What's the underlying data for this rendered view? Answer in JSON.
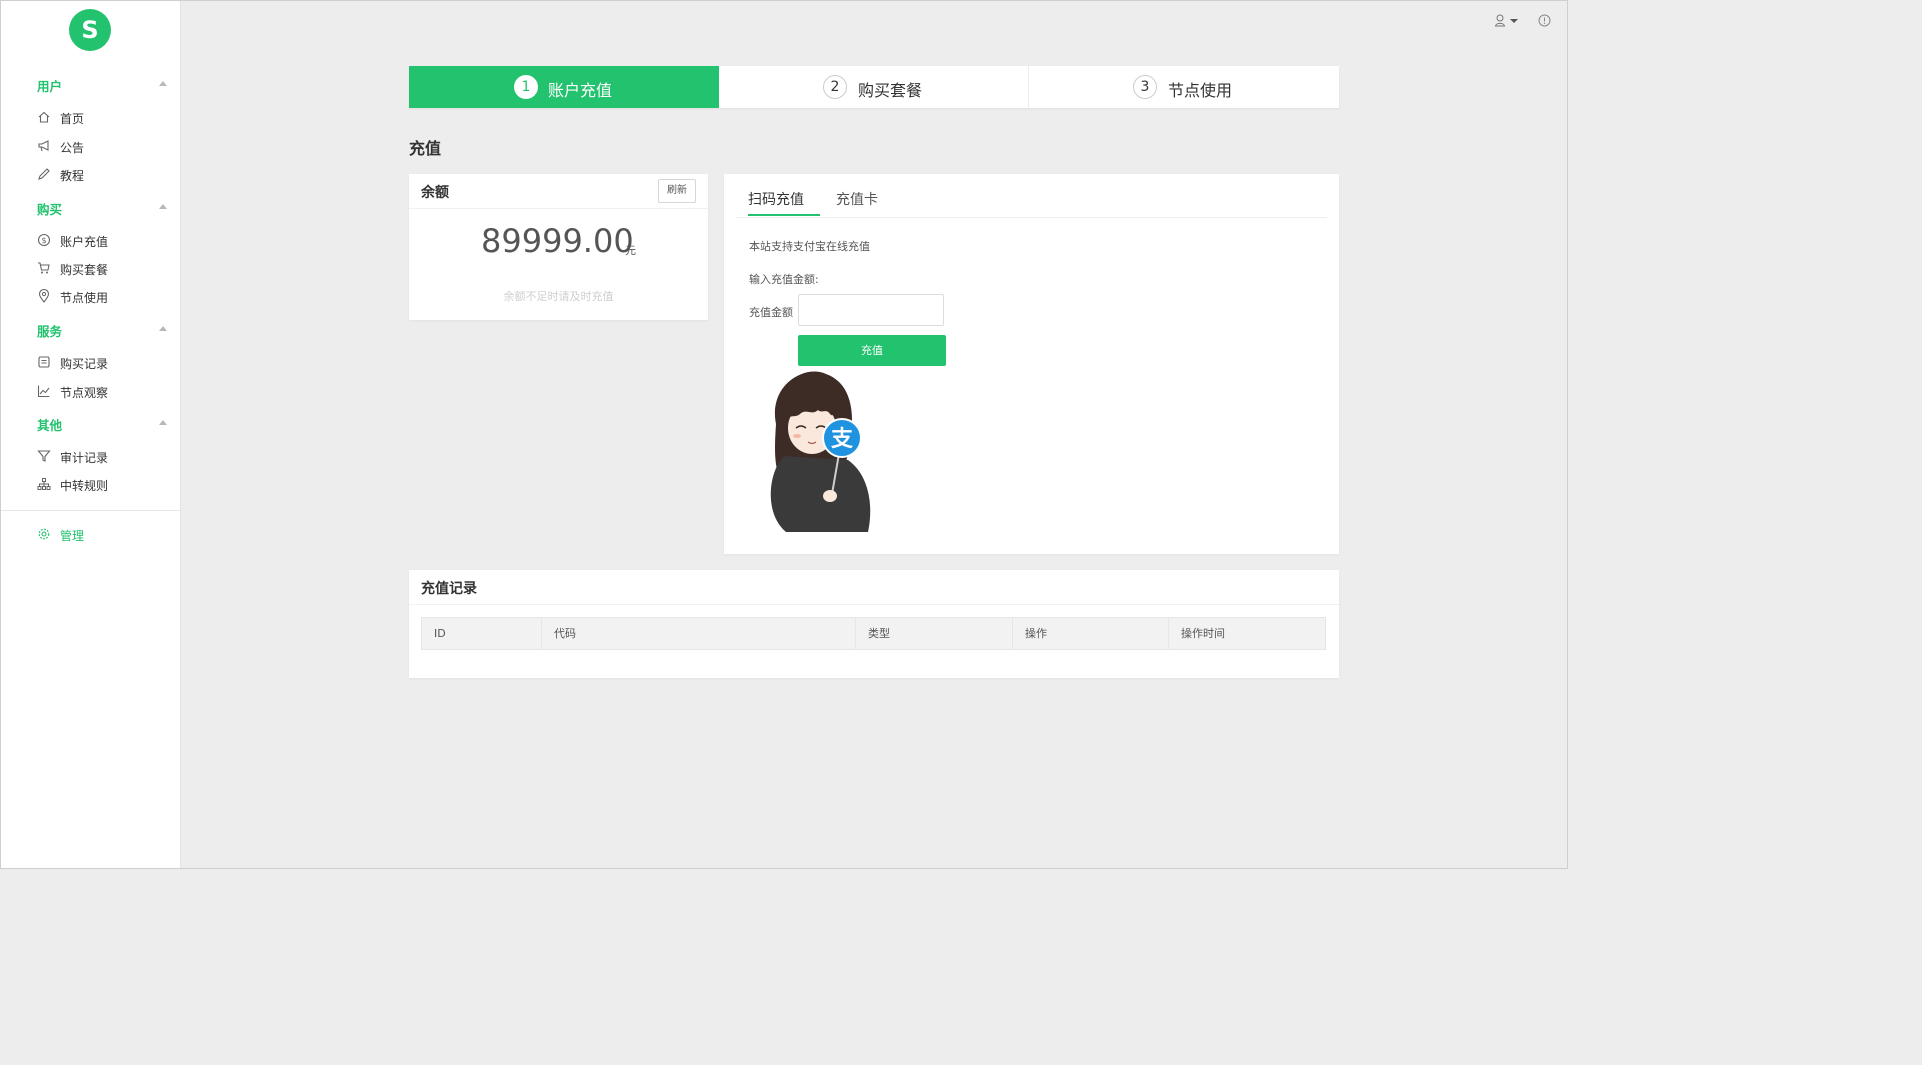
{
  "brand": {
    "logo_letter": "S",
    "accent": "#22c26e"
  },
  "sidebar": {
    "groups": [
      {
        "title": "用户",
        "items": [
          {
            "label": "首页",
            "icon": "home-icon"
          },
          {
            "label": "公告",
            "icon": "megaphone-icon"
          },
          {
            "label": "教程",
            "icon": "pencil-icon"
          }
        ]
      },
      {
        "title": "购买",
        "items": [
          {
            "label": "账户充值",
            "icon": "dollar-circle-icon"
          },
          {
            "label": "购买套餐",
            "icon": "cart-icon"
          },
          {
            "label": "节点使用",
            "icon": "location-pin-icon"
          }
        ]
      },
      {
        "title": "服务",
        "items": [
          {
            "label": "购买记录",
            "icon": "list-doc-icon"
          },
          {
            "label": "节点观察",
            "icon": "line-chart-icon"
          }
        ]
      },
      {
        "title": "其他",
        "items": [
          {
            "label": "审计记录",
            "icon": "filter-icon"
          },
          {
            "label": "中转规则",
            "icon": "sitemap-icon"
          }
        ]
      }
    ],
    "admin": {
      "label": "管理",
      "icon": "gear-icon"
    }
  },
  "steps": [
    {
      "num": "1",
      "label": "账户充值",
      "active": true
    },
    {
      "num": "2",
      "label": "购买套餐",
      "active": false
    },
    {
      "num": "3",
      "label": "节点使用",
      "active": false
    }
  ],
  "page_title": "充值",
  "balance": {
    "title": "余额",
    "refresh_label": "刷新",
    "amount": "89999.00",
    "unit": "元",
    "hint": "余额不足时请及时充值"
  },
  "recharge": {
    "tabs": [
      "扫码充值",
      "充值卡"
    ],
    "active_tab": 0,
    "support_text": "本站支持支付宝在线充值",
    "input_prompt": "输入充值金额:",
    "amount_label": "充值金额",
    "amount_value": "",
    "button_label": "充值",
    "mascot_badge": "支"
  },
  "records": {
    "title": "充值记录",
    "columns": [
      "ID",
      "代码",
      "类型",
      "操作",
      "操作时间"
    ],
    "rows": []
  }
}
